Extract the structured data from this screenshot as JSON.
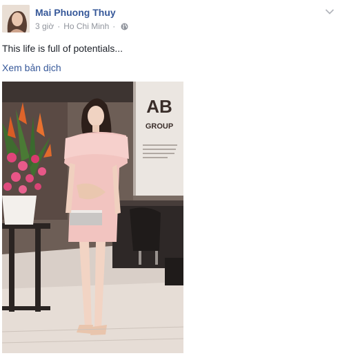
{
  "post": {
    "author": "Mai Phuong Thuy",
    "time": "3 giờ",
    "separator": "·",
    "location": "Ho Chi Minh",
    "separator2": "·",
    "privacy_icon": "globe-icon",
    "menu_icon": "chevron-down-icon",
    "text": "This life is full of potentials...",
    "translate_link": "Xem bản dịch",
    "photo": {
      "sign_logo": "AB",
      "sign_brand": "GROUP"
    }
  },
  "colors": {
    "link": "#365899",
    "meta": "#90949c",
    "text": "#1d2129"
  }
}
